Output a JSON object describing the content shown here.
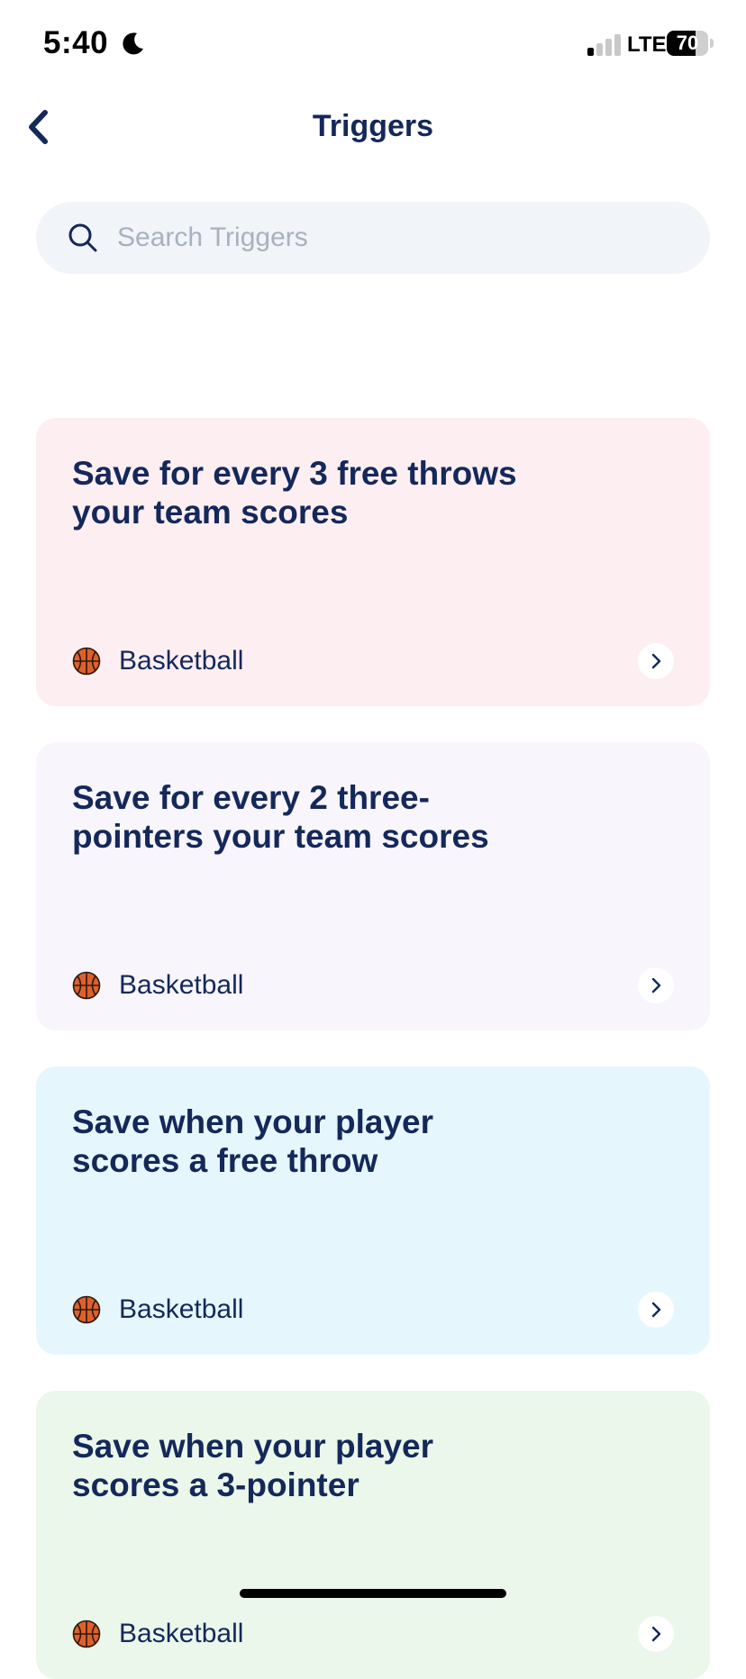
{
  "status_bar": {
    "time": "5:40",
    "network": "LTE",
    "battery": "70",
    "battery_level": 0.7
  },
  "nav": {
    "title": "Triggers",
    "back_icon": "chevron-left-icon"
  },
  "search": {
    "placeholder": "Search Triggers",
    "value": ""
  },
  "triggers": [
    {
      "title": "Save for every 3 free throws your team scores",
      "sport": "Basketball",
      "background": "#fdeef1"
    },
    {
      "title": "Save for every 2 three-pointers your team scores",
      "sport": "Basketball",
      "background": "#f8f5fd"
    },
    {
      "title": "Save when your player scores a free throw",
      "sport": "Basketball",
      "background": "#e5f7fd"
    },
    {
      "title": "Save when your player scores a 3-pointer",
      "sport": "Basketball",
      "background": "#eaf7ea"
    }
  ],
  "colors": {
    "primary_text": "#14285a",
    "basketball": "#e0602a"
  }
}
